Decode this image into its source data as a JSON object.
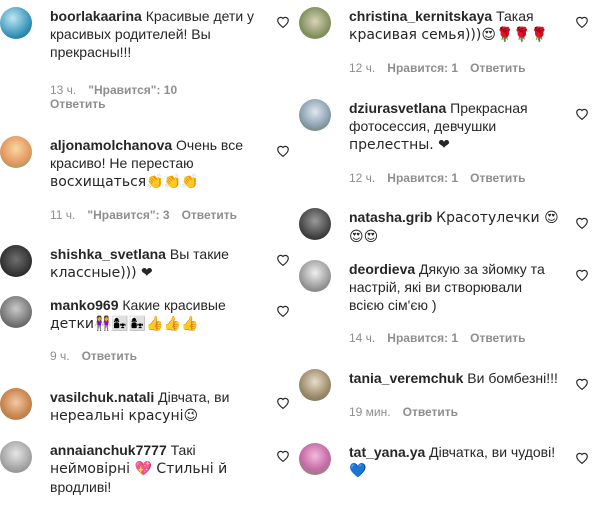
{
  "labels": {
    "reply": "Ответить"
  },
  "colors": {
    "heart_red": "#ed4956",
    "heart_blue": "#3897f0",
    "meta": "#8e8e8e"
  },
  "left_column": [
    {
      "username": "boorlakaarina",
      "lines": [
        "Красивые дети у",
        "красивых родителей! Вы",
        "прекрасны!!!"
      ],
      "time": "13 ч.",
      "likes": "\"Нравится\": 10"
    },
    {
      "username": "aljonamolchanova",
      "lines": [
        "Очень все",
        "красиво! Не перестаю",
        "восхищаться👏👏👏"
      ],
      "time": "11 ч.",
      "likes": "\"Нравится\": 3"
    },
    {
      "username": "shishka_svetlana",
      "lines": [
        "Вы такие",
        "классные))) ❤"
      ]
    },
    {
      "username": "manko969",
      "lines": [
        "Какие красивые",
        "детки👭👩‍👧👩‍👧👍👍👍"
      ],
      "time": "9 ч."
    },
    {
      "username": "vasilchuk.natali",
      "lines": [
        "Дівчата, ви",
        "нереальні красуні😉"
      ]
    },
    {
      "username": "annaianchuk7777",
      "lines": [
        "Такі",
        "неймовірні 💖 Стильні й",
        "вродливі!"
      ]
    }
  ],
  "right_column": [
    {
      "username": "christina_kernitskaya",
      "lines": [
        "Такая",
        "красивая семья)))😍🌹🌹🌹"
      ],
      "time": "12 ч.",
      "likes": "Нравится: 1"
    },
    {
      "username": "dziurasvetlana",
      "lines": [
        "Прекрасная",
        "фотосессия, девчушки",
        "прелестны. ❤"
      ],
      "time": "12 ч.",
      "likes": "Нравится: 1"
    },
    {
      "username": "natasha.grib",
      "lines": [
        "Красотулечки 😍",
        "😍😍"
      ]
    },
    {
      "username": "deordieva",
      "lines": [
        "Дякую за зйомку та",
        "настрій, які ви створювали",
        "всією сім'єю )"
      ],
      "time": "14 ч.",
      "likes": "Нравится: 1"
    },
    {
      "username": "tania_veremchuk",
      "lines": [
        "Ви бомбезні!!!"
      ],
      "time": "19 мин."
    },
    {
      "username": "tat_yana.ya",
      "lines": [
        "Дівчатка, ви чудові!",
        "💙"
      ]
    }
  ]
}
